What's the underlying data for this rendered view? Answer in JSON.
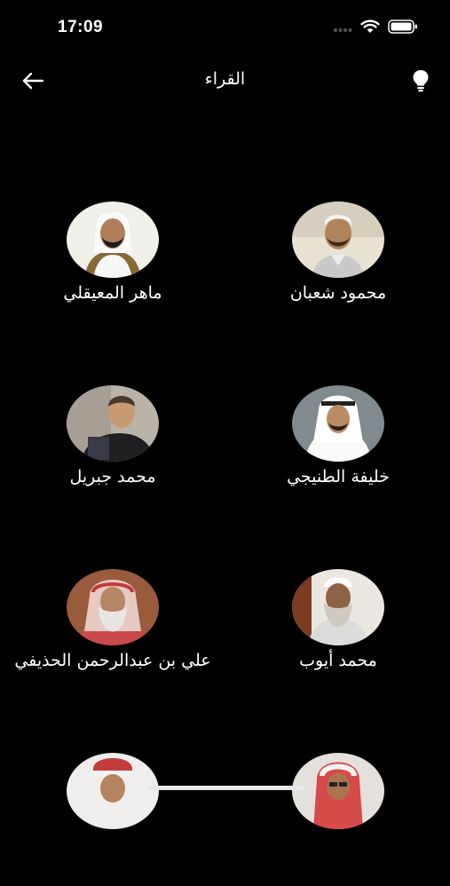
{
  "status_bar": {
    "time": "17:09"
  },
  "nav": {
    "title": "القراء"
  },
  "reciters": [
    {
      "name": "محمود شعبان"
    },
    {
      "name": "ماهر المعيقلي"
    },
    {
      "name": "خليفة الطنيجي"
    },
    {
      "name": "محمد جبريل"
    },
    {
      "name": "محمد أيوب"
    },
    {
      "name": "علي بن عبدالرحمن الحذيفي"
    },
    {
      "name": ""
    },
    {
      "name": ""
    }
  ],
  "icons": {
    "back": "arrow-left-icon",
    "theme": "lightbulb-icon",
    "wifi": "wifi-icon",
    "battery": "battery-icon",
    "signal": "signal-icon"
  },
  "colors": {
    "background": "#000000",
    "text": "#ffffff"
  }
}
